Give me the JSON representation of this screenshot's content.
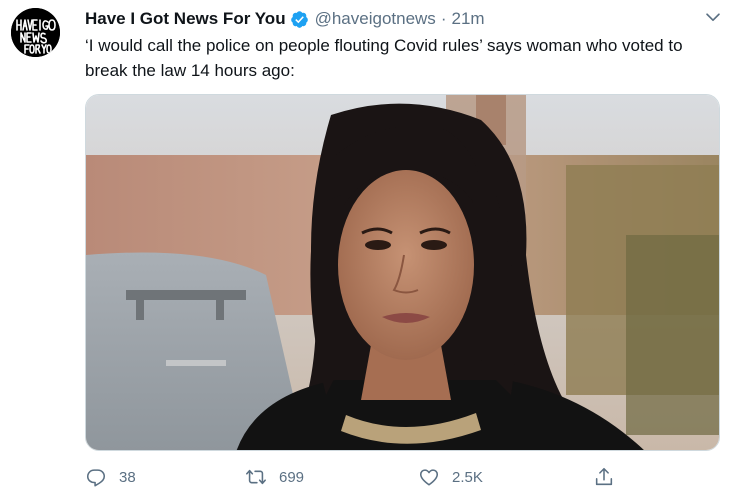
{
  "tweet": {
    "display_name": "Have I Got News For You",
    "handle": "@haveigotnews",
    "separator": "·",
    "time": "21m",
    "text": "‘I would call the police on people flouting Covid rules’ says woman who voted to break the law 14 hours ago:",
    "avatar_logo_text": "HAVE I GOT NEWS FOR YOU",
    "verified_icon": "verified-badge-icon",
    "more_icon": "chevron-down-icon",
    "media_alt": "woman-speaking-in-front-of-river-view-photo"
  },
  "actions": {
    "reply": {
      "icon": "reply-icon",
      "count": "38"
    },
    "retweet": {
      "icon": "retweet-icon",
      "count": "699"
    },
    "like": {
      "icon": "heart-icon",
      "count": "2.5K"
    },
    "share": {
      "icon": "share-icon"
    }
  },
  "colors": {
    "text": "#0f1419",
    "secondary": "#5b7083",
    "verified": "#1da1f2",
    "border": "#cfd9de"
  }
}
